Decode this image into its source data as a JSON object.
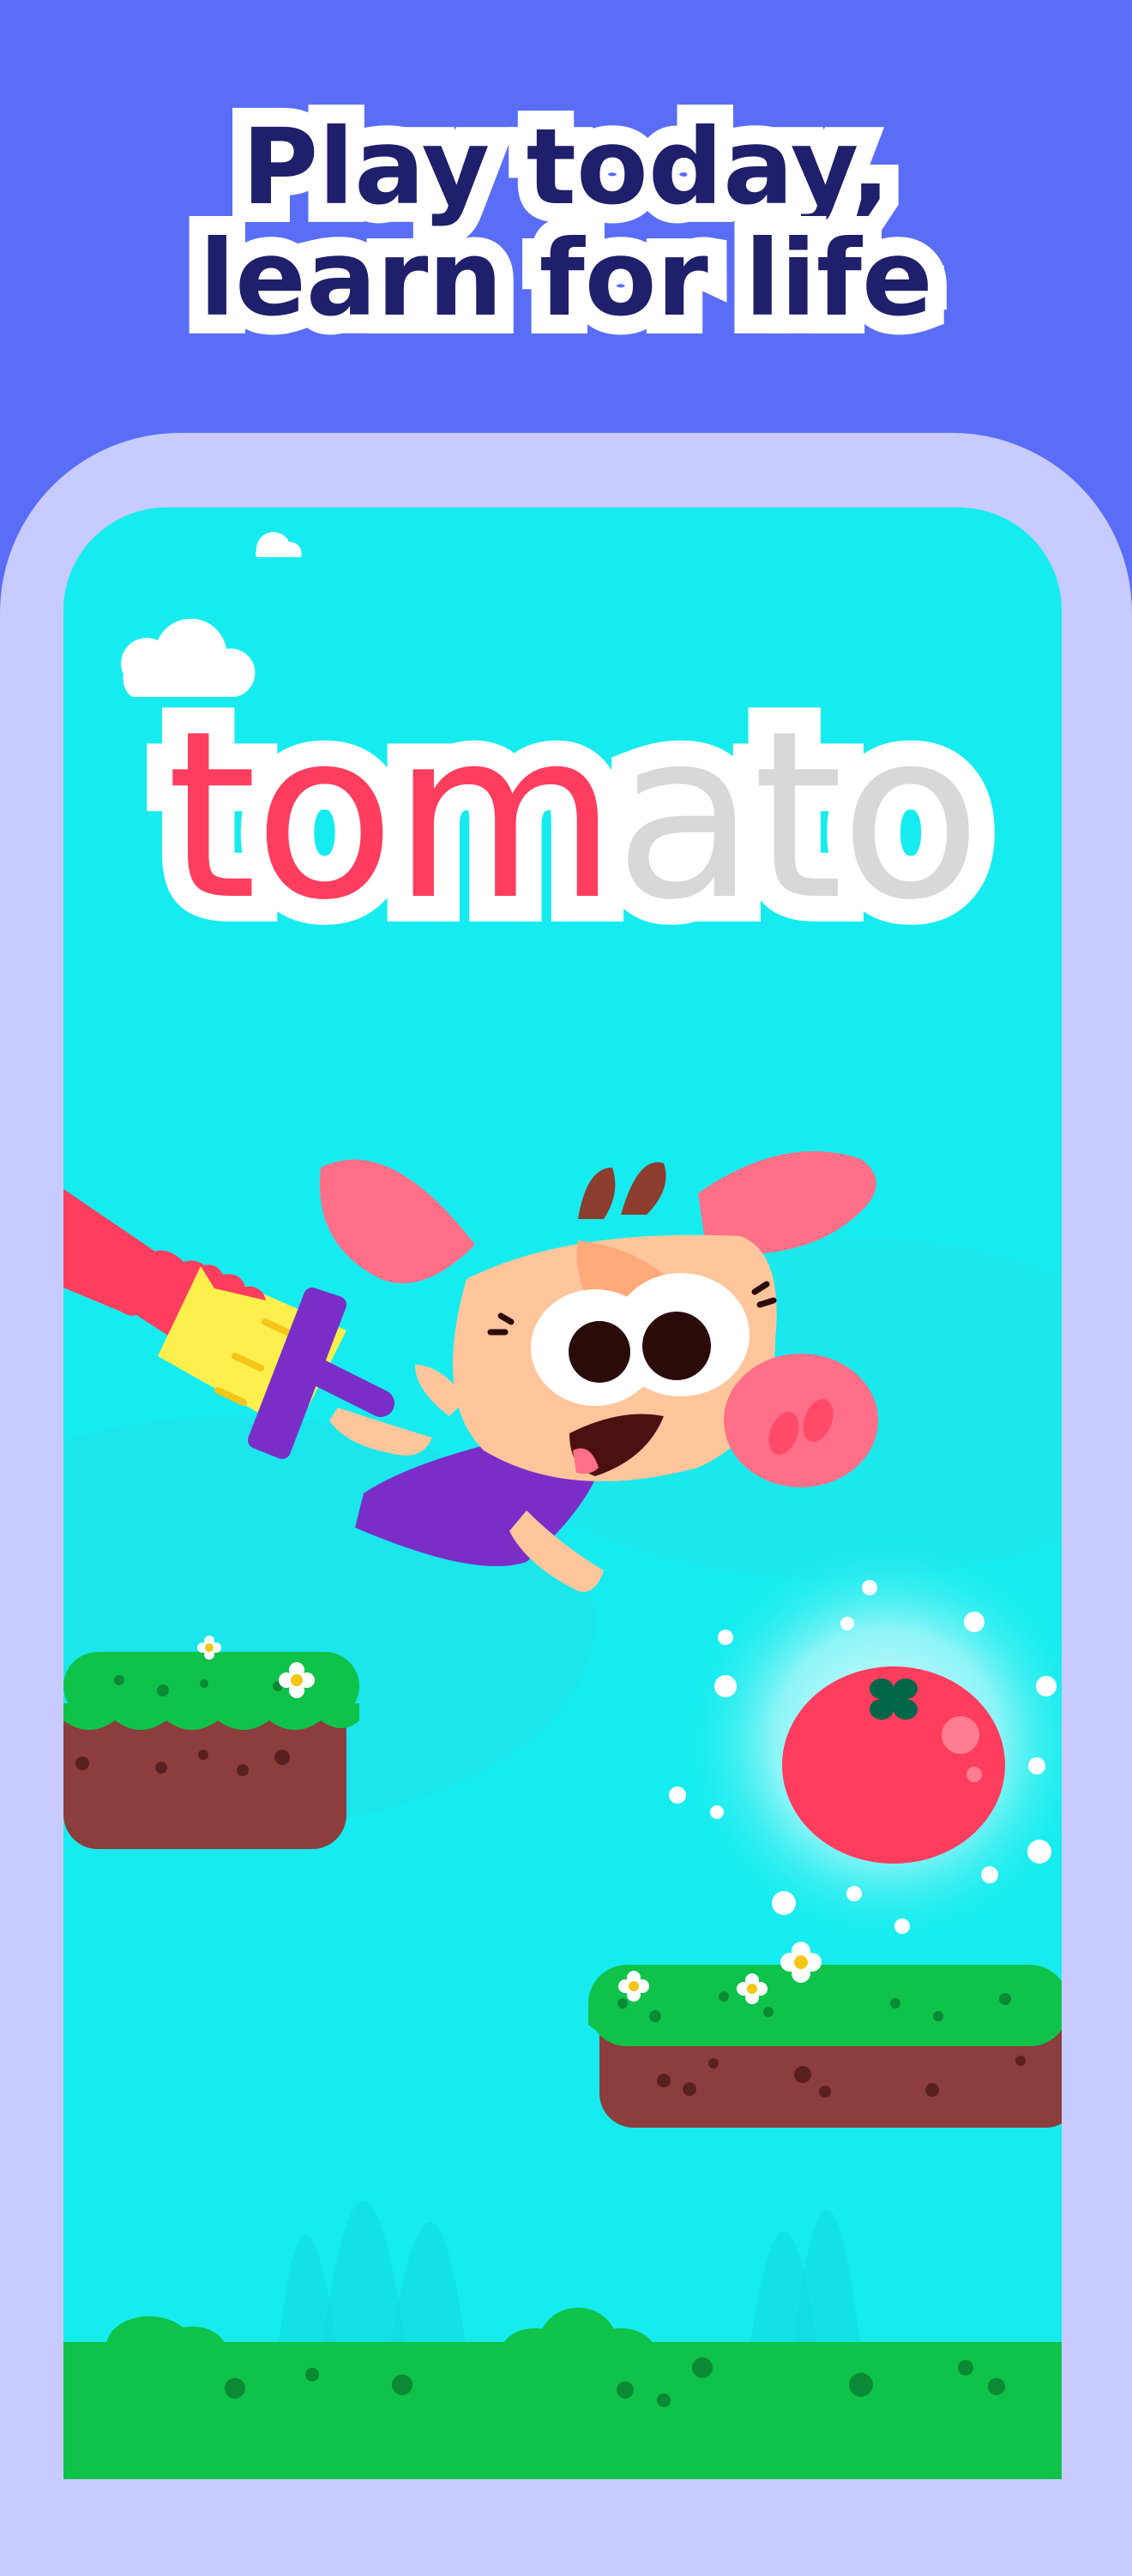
{
  "headline": {
    "line1": "Play today,",
    "line2": "learn for life"
  },
  "word": {
    "traced": "tom",
    "untraced": "ato"
  },
  "colors": {
    "background": "#5a6df7",
    "phone_frame": "#c7cbff",
    "screen": "#16ecef",
    "traced_letters": "#ff3d5e",
    "untraced_letters": "#d8d8d8",
    "headline_text": "#1f1f6b",
    "grass": "#0fc24a",
    "dirt": "#8c3d3d"
  },
  "icons": [
    "cloud-icon",
    "paintbrush-icon",
    "pig-character",
    "tomato-icon",
    "flower-icon"
  ]
}
